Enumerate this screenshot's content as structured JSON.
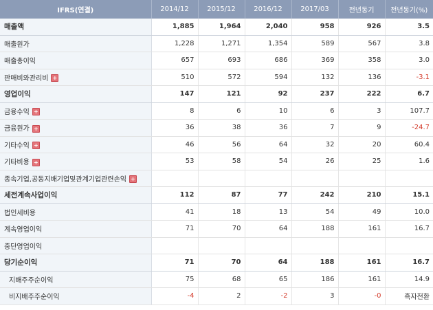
{
  "table": {
    "headers": [
      "IFRS(연결)",
      "2014/12",
      "2015/12",
      "2016/12",
      "2017/03",
      "전년동기",
      "전년동기(%)"
    ],
    "rows": [
      {
        "label": "매출액",
        "values": [
          "1,885",
          "1,964",
          "2,040",
          "958",
          "926",
          "3.5"
        ],
        "major": true
      },
      {
        "label": "매출원가",
        "values": [
          "1,228",
          "1,271",
          "1,354",
          "589",
          "567",
          "3.8"
        ]
      },
      {
        "label": "매출총이익",
        "values": [
          "657",
          "693",
          "686",
          "369",
          "358",
          "3.0"
        ]
      },
      {
        "label": "판매비와관리비",
        "values": [
          "510",
          "572",
          "594",
          "132",
          "136",
          "-3.1"
        ],
        "expand": true
      },
      {
        "label": "영업이익",
        "values": [
          "147",
          "121",
          "92",
          "237",
          "222",
          "6.7"
        ],
        "major": true
      },
      {
        "label": "금융수익",
        "values": [
          "8",
          "6",
          "10",
          "6",
          "3",
          "107.7"
        ],
        "expand": true
      },
      {
        "label": "금융원가",
        "values": [
          "36",
          "38",
          "36",
          "7",
          "9",
          "-24.7"
        ],
        "expand": true
      },
      {
        "label": "기타수익",
        "values": [
          "46",
          "56",
          "64",
          "32",
          "20",
          "60.4"
        ],
        "expand": true
      },
      {
        "label": "기타비용",
        "values": [
          "53",
          "58",
          "54",
          "26",
          "25",
          "1.6"
        ],
        "expand": true
      },
      {
        "label": "종속기업,공동지배기업및관계기업관련손익",
        "values": [
          "",
          "",
          "",
          "",
          "",
          ""
        ],
        "expand": true
      },
      {
        "label": "세전계속사업이익",
        "values": [
          "112",
          "87",
          "77",
          "242",
          "210",
          "15.1"
        ],
        "major": true
      },
      {
        "label": "법인세비용",
        "values": [
          "41",
          "18",
          "13",
          "54",
          "49",
          "10.0"
        ]
      },
      {
        "label": "계속영업이익",
        "values": [
          "71",
          "70",
          "64",
          "188",
          "161",
          "16.7"
        ]
      },
      {
        "label": "중단영업이익",
        "values": [
          "",
          "",
          "",
          "",
          "",
          ""
        ]
      },
      {
        "label": "당기순이익",
        "values": [
          "71",
          "70",
          "64",
          "188",
          "161",
          "16.7"
        ],
        "major": true
      },
      {
        "label": "지배주주순이익",
        "values": [
          "75",
          "68",
          "65",
          "186",
          "161",
          "14.9"
        ],
        "indent": true
      },
      {
        "label": "비지배주주순이익",
        "values": [
          "-4",
          "2",
          "-2",
          "3",
          "-0",
          "흑자전환"
        ],
        "indent": true
      }
    ],
    "expand_icon": "plus-icon",
    "colors": {
      "header_bg": "#8c9cb7",
      "label_bg": "#f1f5f9",
      "negative": "#d43c2c",
      "expand_icon": "#e4747a"
    }
  }
}
